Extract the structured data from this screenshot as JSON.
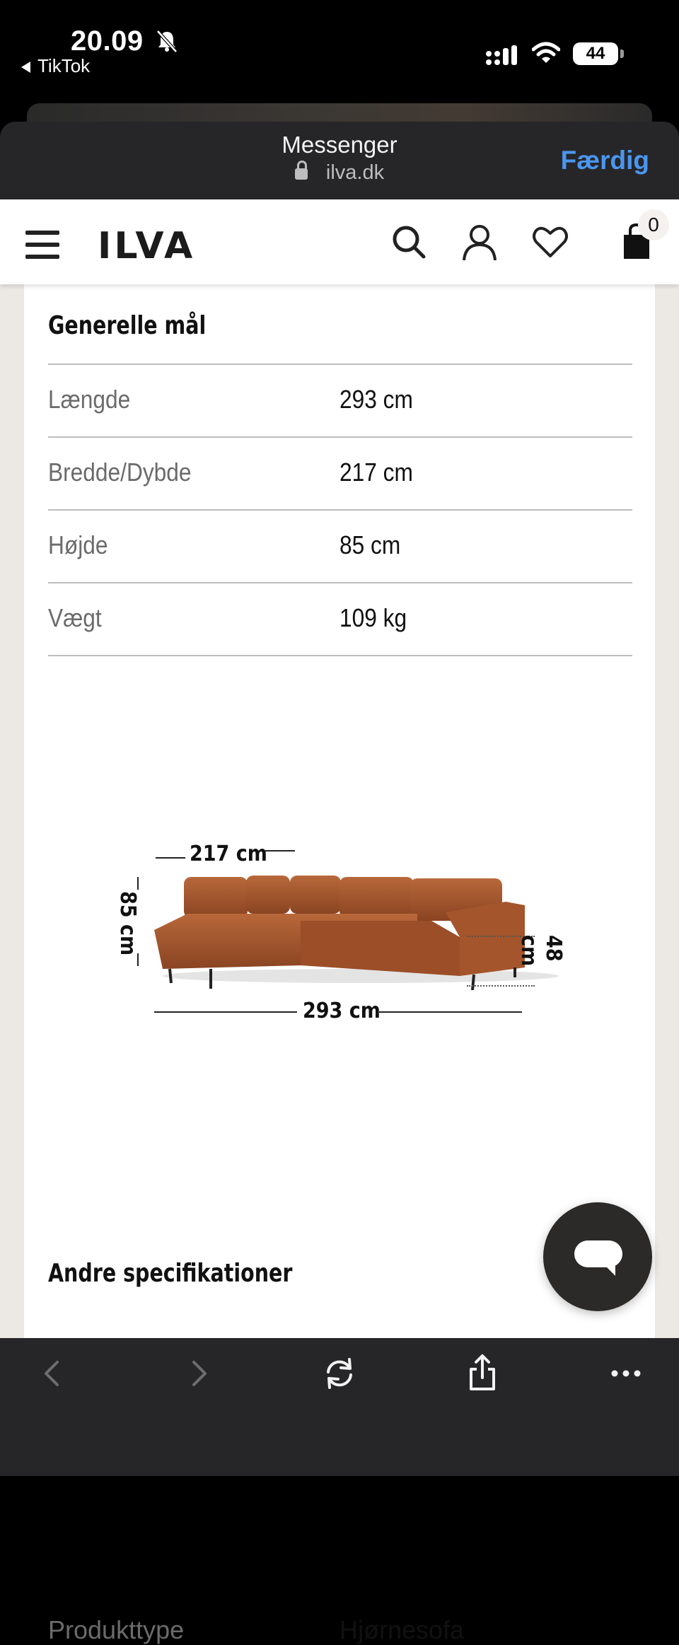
{
  "status_bar": {
    "time": "20.09",
    "back_app": "TikTok",
    "battery": "44"
  },
  "browser": {
    "title": "Messenger",
    "url": "ilva.dk",
    "done_label": "Færdig"
  },
  "site": {
    "logo": "ILVA",
    "cart_count": "0"
  },
  "general": {
    "title": "Generelle mål",
    "rows": [
      {
        "label": "Længde",
        "value": "293 cm"
      },
      {
        "label": "Bredde/Dybde",
        "value": "217 cm"
      },
      {
        "label": "Højde",
        "value": "85 cm"
      },
      {
        "label": "Vægt",
        "value": "109 kg"
      }
    ]
  },
  "diagram": {
    "depth": "217 cm",
    "height": "85 cm",
    "seat_height": "48 cm",
    "length": "293 cm",
    "sofa_color": "#a5552c"
  },
  "other": {
    "title": "Andre specifikationer",
    "peek_label": "Produkttype",
    "peek_value": "Hjørnesofa"
  }
}
